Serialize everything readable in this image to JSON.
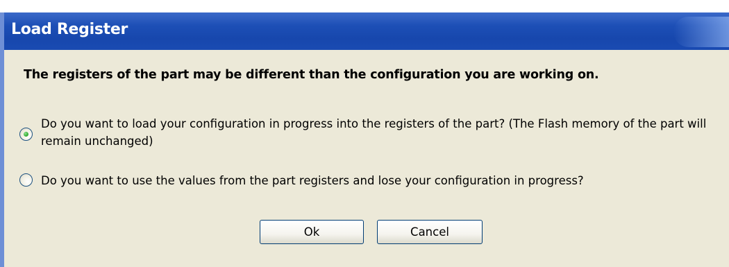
{
  "window": {
    "title": "Load Register"
  },
  "dialog": {
    "headline": "The registers of the part may be different than the configuration you are working on.",
    "options": [
      {
        "label": "Do you want to load your configuration in progress into the registers of the part? (The Flash memory of the part will remain unchanged)",
        "selected": true
      },
      {
        "label": "Do you want to use the values from the part registers and lose your configuration in progress?",
        "selected": false
      }
    ],
    "ok_label": "Ok",
    "cancel_label": "Cancel"
  },
  "colors": {
    "titlebar": "#1d4fb6",
    "body": "#ece9d8",
    "radio_dot": "#3eb33e"
  }
}
